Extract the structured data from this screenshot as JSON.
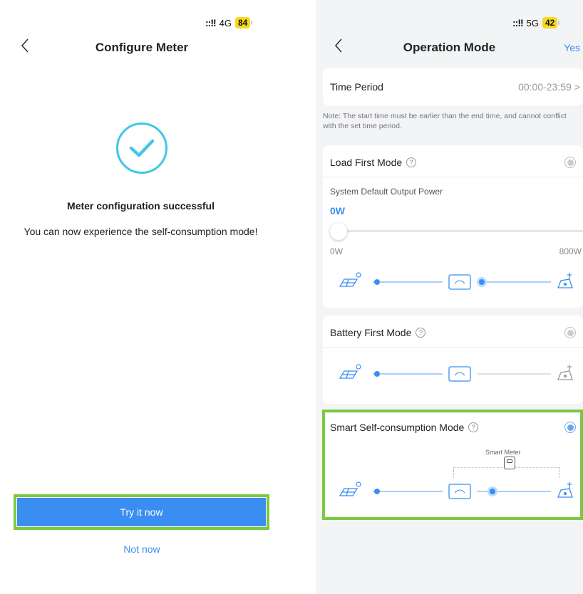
{
  "left_screen": {
    "status_bar": {
      "signal": "::!!",
      "network": "4G",
      "battery": "84"
    },
    "header": {
      "title": "Configure Meter"
    },
    "success": {
      "title": "Meter configuration successful",
      "description": "You can now experience the self-consumption mode!"
    },
    "actions": {
      "primary_label": "Try it now",
      "secondary_label": "Not now"
    }
  },
  "right_screen": {
    "status_bar": {
      "signal": "::!!",
      "network": "5G",
      "battery": "42"
    },
    "header": {
      "title": "Operation Mode",
      "action_label": "Yes"
    },
    "time_period": {
      "label": "Time Period",
      "value": "00:00-23:59",
      "chevron": ">"
    },
    "note": "Note: The start time must be earlier than the end time, and cannot conflict with the set time period.",
    "modes": [
      {
        "title": "Load First Mode",
        "selected": false,
        "output_power_label": "System Default Output Power",
        "output_power_value": "0W",
        "slider": {
          "value_fraction": 0.0,
          "min_label": "0W",
          "max_label": "800W"
        }
      },
      {
        "title": "Battery First Mode",
        "selected": false
      },
      {
        "title": "Smart Self-consumption Mode",
        "selected": true,
        "meter_label": "Smart Meter"
      }
    ],
    "help_glyph": "?"
  },
  "colors": {
    "accent": "#3a8ef2",
    "success": "#42c6e6",
    "highlight": "#7ac943",
    "flow_active": "#3a8ef2"
  },
  "icons": [
    "chevron-left-icon",
    "check-icon",
    "solar-panel-icon",
    "battery-icon",
    "house-icon",
    "smart-meter-icon",
    "help-icon",
    "radio-icon"
  ]
}
